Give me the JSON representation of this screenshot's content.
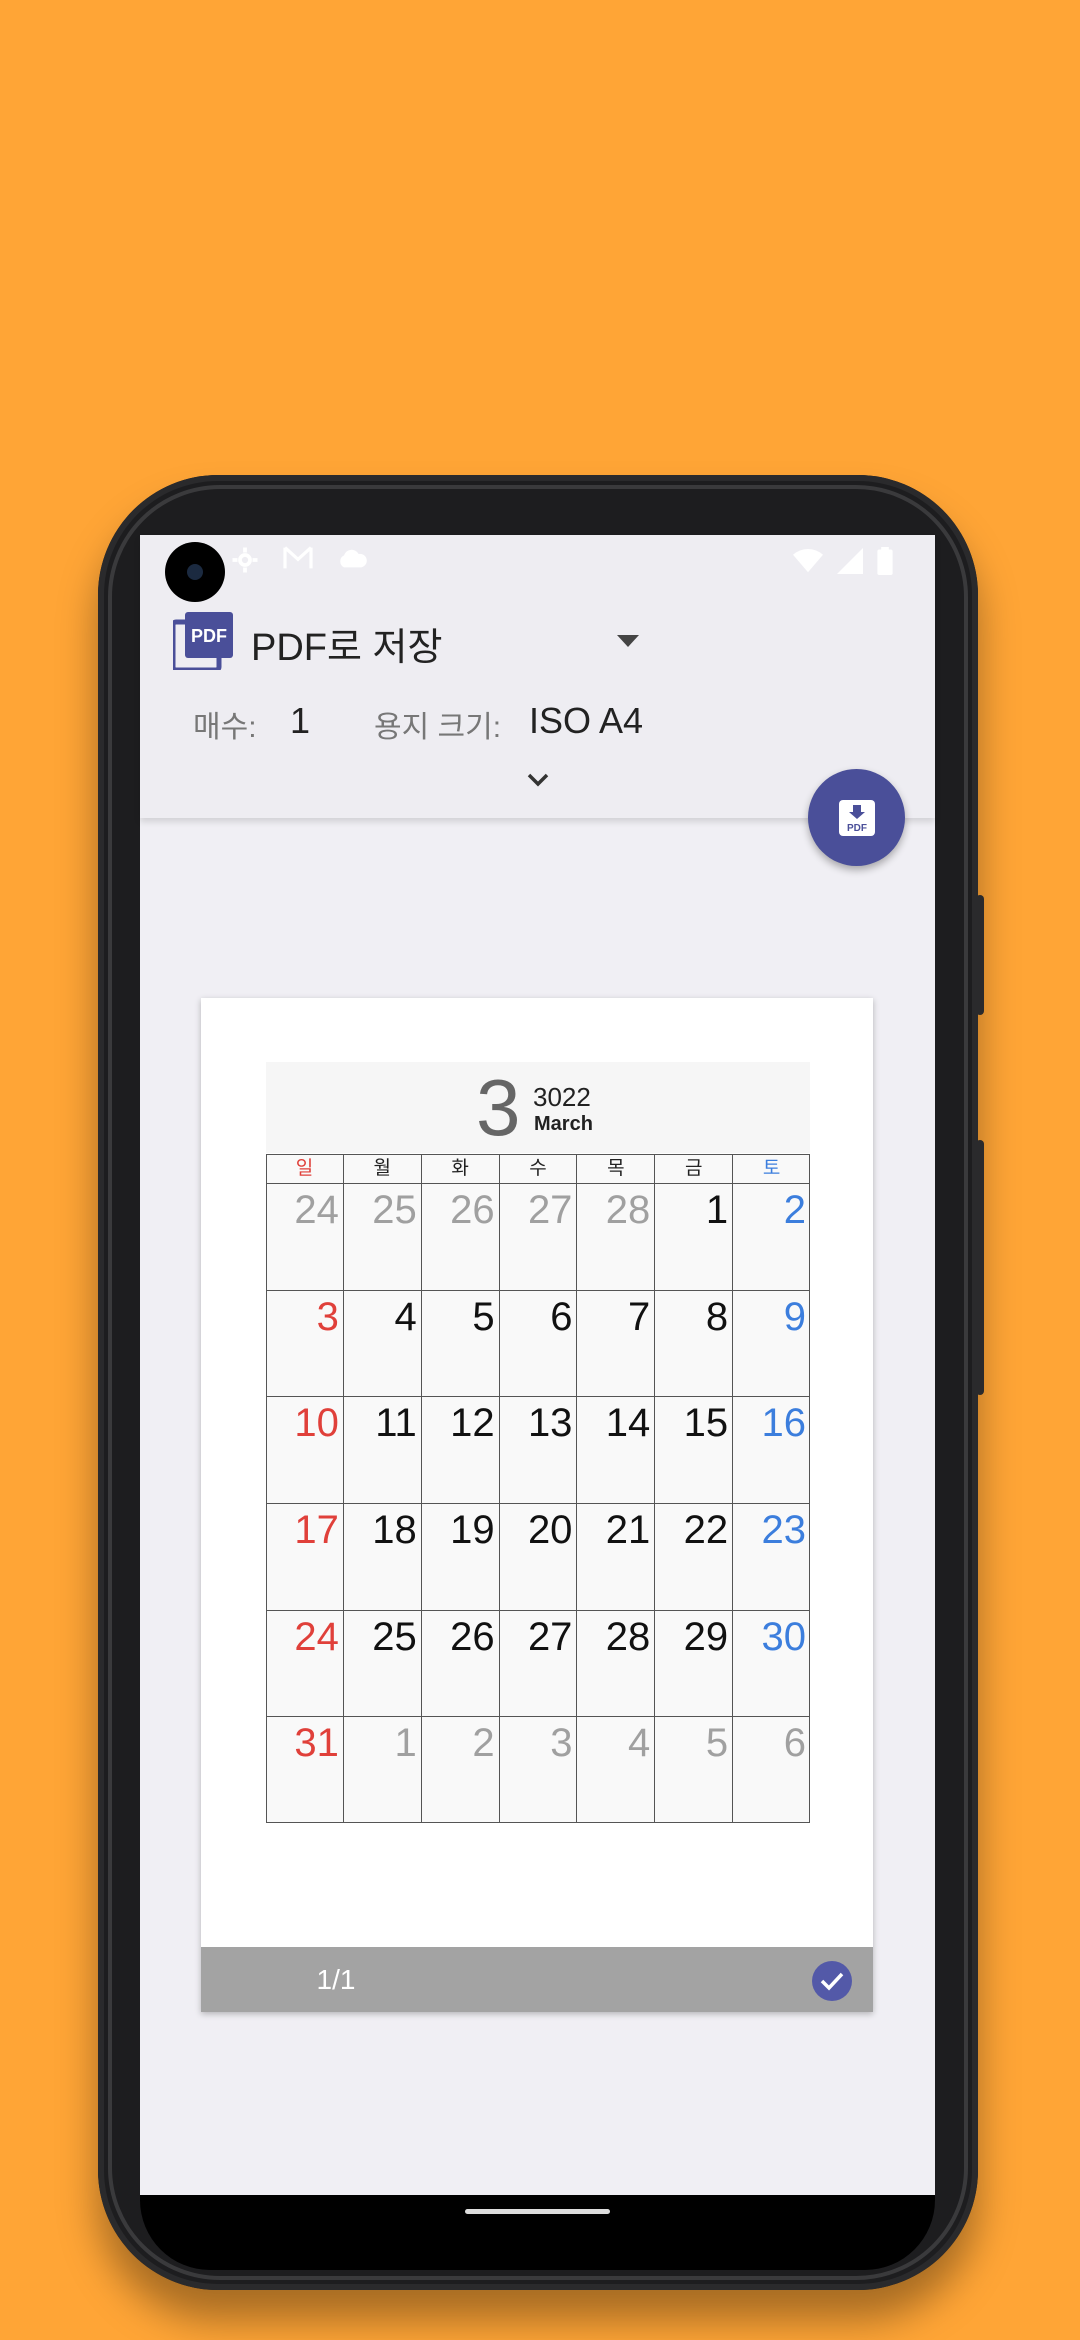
{
  "header": {
    "printer_name": "PDF로 저장",
    "copies_label": "매수:",
    "copies_value": "1",
    "paper_label": "용지 크기:",
    "paper_value": "ISO A4",
    "pdf_logo_text": "PDF",
    "fab_icon_text": "PDF"
  },
  "preview": {
    "page_indicator": "1/1",
    "calendar": {
      "month_number": "3",
      "year": "3022",
      "month_name": "March",
      "weekdays": [
        "일",
        "월",
        "화",
        "수",
        "목",
        "금",
        "토"
      ],
      "weeks": [
        [
          "24",
          "25",
          "26",
          "27",
          "28",
          "1",
          "2"
        ],
        [
          "3",
          "4",
          "5",
          "6",
          "7",
          "8",
          "9"
        ],
        [
          "10",
          "11",
          "12",
          "13",
          "14",
          "15",
          "16"
        ],
        [
          "17",
          "18",
          "19",
          "20",
          "21",
          "22",
          "23"
        ],
        [
          "24",
          "25",
          "26",
          "27",
          "28",
          "29",
          "30"
        ],
        [
          "31",
          "1",
          "2",
          "3",
          "4",
          "5",
          "6"
        ]
      ]
    }
  },
  "colors": {
    "background": "#FFA536",
    "accent": "#4A4F99",
    "sunday": "#E0403A",
    "saturday": "#3C7EDD",
    "out_of_month": "#A0A0A0"
  }
}
